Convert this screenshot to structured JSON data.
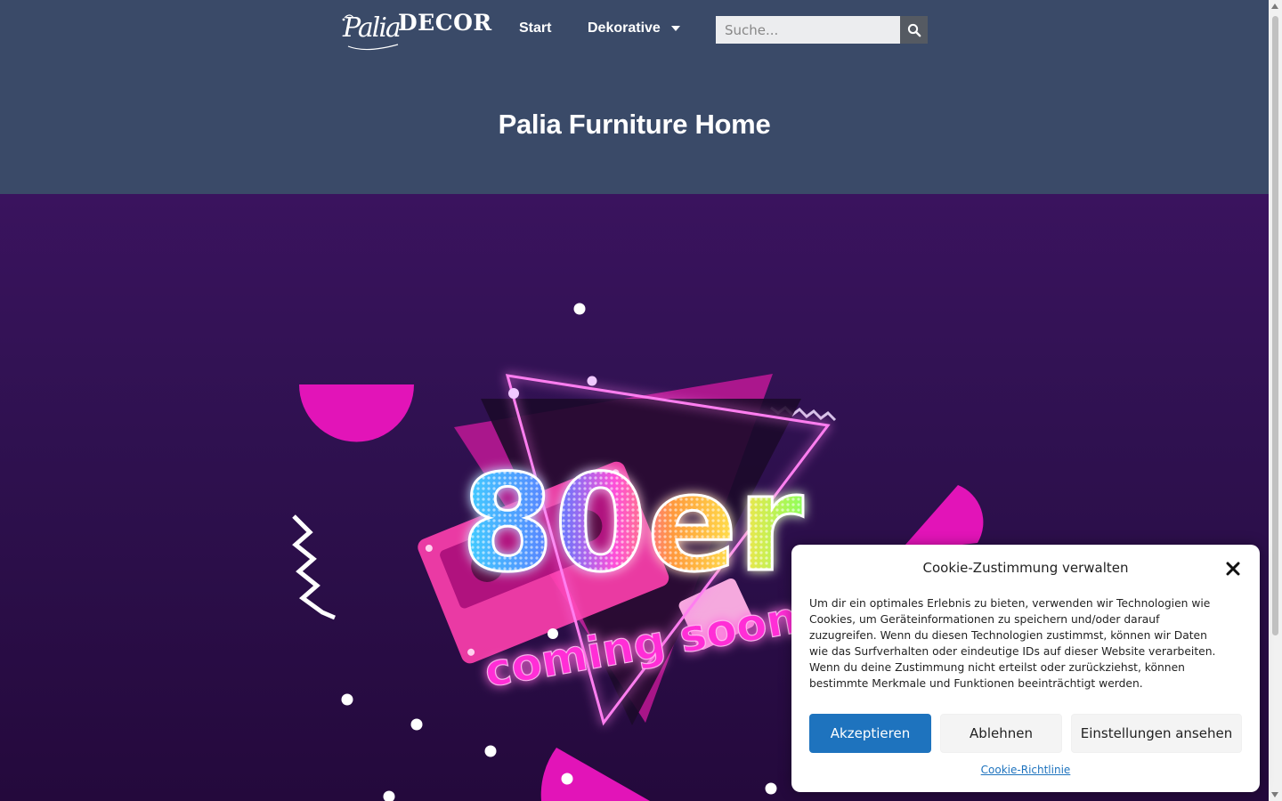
{
  "header": {
    "logo": {
      "script": "Palia",
      "word": "DECOR"
    },
    "nav": [
      {
        "label": "Start"
      },
      {
        "label": "Dekorative"
      }
    ],
    "search": {
      "placeholder": "Suche...",
      "value": ""
    },
    "page_title": "Palia Furniture Home"
  },
  "hero": {
    "headline": "80er",
    "tagline": "coming soon",
    "colors": {
      "neon_pink": "#ff1fbf",
      "bg_top": "#3a135e",
      "bg_bottom": "#24093c"
    }
  },
  "cookie_dialog": {
    "title": "Cookie-Zustimmung verwalten",
    "text": "Um dir ein optimales Erlebnis zu bieten, verwenden wir Technologien wie Cookies, um Geräteinformationen zu speichern und/oder darauf zuzugreifen. Wenn du diesen Technologien zustimmst, können wir Daten wie das Surfverhalten oder eindeutige IDs auf dieser Website verarbeiten. Wenn du deine Zustimmung nicht erteilst oder zurückziehst, können bestimmte Merkmale und Funktionen beeinträchtigt werden.",
    "accept_label": "Akzeptieren",
    "deny_label": "Ablehnen",
    "prefs_label": "Einstellungen ansehen",
    "policy_link": "Cookie-Richtlinie",
    "accent": "#1e73be"
  }
}
